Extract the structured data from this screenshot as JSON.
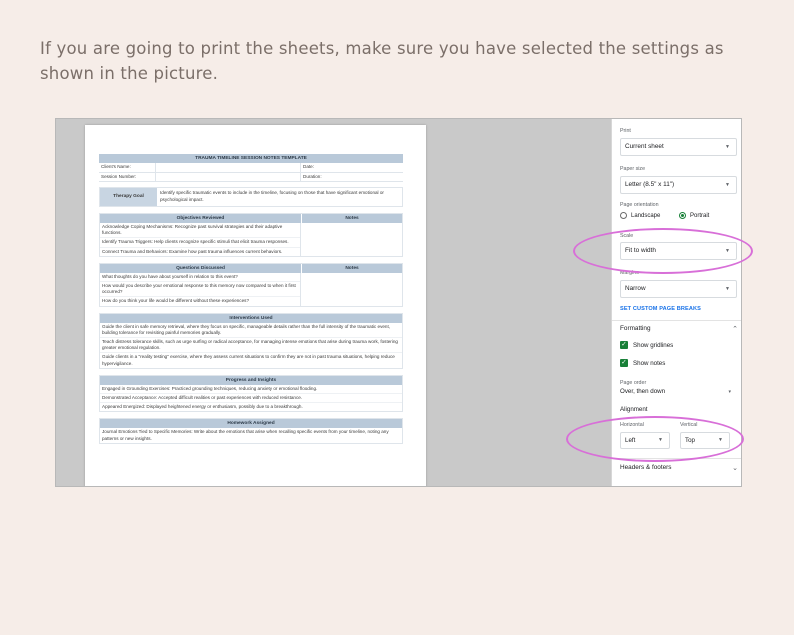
{
  "instruction": "If you are going to print the sheets, make sure you have selected the settings as shown in the picture.",
  "document": {
    "title": "TRAUMA TIMELINE SESSION NOTES TEMPLATE",
    "client_label": "Client's Name:",
    "date_label": "Date:",
    "session_label": "Session Number:",
    "duration_label": "Duration:",
    "goal_label": "Therapy Goal",
    "goal_text": "Identify specific traumatic events to include in the timeline, focusing on those that have significant emotional or psychological impact.",
    "objectives_header": "Objectives Reviewed",
    "notes_header": "Notes",
    "objectives": [
      "Acknowledge Coping Mechanisms: Recognize past survival strategies and their adaptive functions.",
      "Identify Trauma Triggers: Help clients recognize specific stimuli that elicit trauma responses.",
      "Connect Trauma and Behaviors: Examine how past trauma influences current behaviors."
    ],
    "questions_header": "Questions Discussed",
    "questions": [
      "What thoughts do you have about yourself in relation to this event?",
      "How would you describe your emotional response to this memory now compared to when it first occurred?",
      "How do you think your life would be different without these experiences?"
    ],
    "interventions_header": "Interventions Used",
    "interventions": [
      "Guide the client in safe memory retrieval, where they focus on specific, manageable details rather than the full intensity of the traumatic event, building tolerance for revisiting painful memories gradually.",
      "Teach distress tolerance skills, such as urge surfing or radical acceptance, for managing intense emotions that arise during trauma work, fostering greater emotional regulation.",
      "Guide clients in a \"reality testing\" exercise, where they assess current situations to confirm they are not in past trauma situations, helping reduce hypervigilance."
    ],
    "progress_header": "Progress and Insights",
    "progress": [
      "Engaged in Grounding Exercises: Practiced grounding techniques, reducing anxiety or emotional flooding.",
      "Demonstrated Acceptance: Accepted difficult realities or past experiences with reduced resistance.",
      "Appeared Energized: Displayed heightened energy or enthusiasm, possibly due to a breakthrough."
    ],
    "homework_header": "Homework Assigned",
    "homework": [
      "Journal Emotions Tied to Specific Memories: Write about the emotions that arise when recalling specific events from your timeline, noting any patterns or new insights."
    ]
  },
  "settings": {
    "print_label": "Print",
    "print_value": "Current sheet",
    "paper_size_label": "Paper size",
    "paper_size_value": "Letter (8.5\" x 11\")",
    "orientation_label": "Page orientation",
    "landscape": "Landscape",
    "portrait": "Portrait",
    "orientation_selected": "Portrait",
    "scale_label": "Scale",
    "scale_value": "Fit to width",
    "margins_label": "Margins",
    "margins_value": "Narrow",
    "custom_breaks": "SET CUSTOM PAGE BREAKS",
    "formatting": "Formatting",
    "show_gridlines": "Show gridlines",
    "show_notes": "Show notes",
    "gridlines_checked": true,
    "notes_checked": true,
    "page_order_label": "Page order",
    "page_order_value": "Over, then down",
    "alignment": "Alignment",
    "horizontal_label": "Horizontal",
    "horizontal_value": "Left",
    "vertical_label": "Vertical",
    "vertical_value": "Top",
    "headers_footers": "Headers & footers"
  },
  "colors": {
    "highlight": "#d86fd8",
    "accent_green": "#188038",
    "link_blue": "#1a73e8",
    "band_blue": "#b9c9d9"
  }
}
